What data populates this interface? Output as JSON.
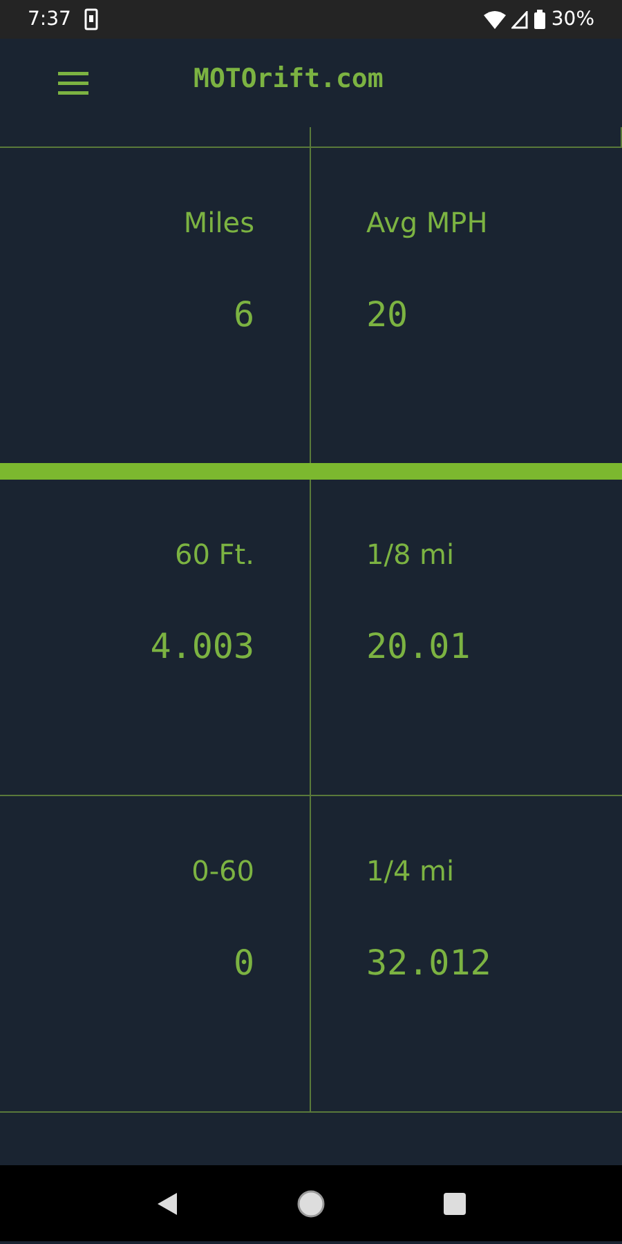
{
  "status_bar": {
    "time": "7:37",
    "battery": "30%"
  },
  "app_bar": {
    "title": "MOTOrift.com"
  },
  "sections": [
    {
      "cells": [
        {
          "label": "Miles",
          "value": "6"
        },
        {
          "label": "Avg MPH",
          "value": "20"
        }
      ]
    },
    {
      "cells": [
        {
          "label": "60 Ft.",
          "value": "4.003"
        },
        {
          "label": "1/8 mi",
          "value": "20.01"
        }
      ]
    },
    {
      "cells": [
        {
          "label": "0-60",
          "value": "0"
        },
        {
          "label": "1/4 mi",
          "value": "32.012"
        }
      ]
    }
  ]
}
